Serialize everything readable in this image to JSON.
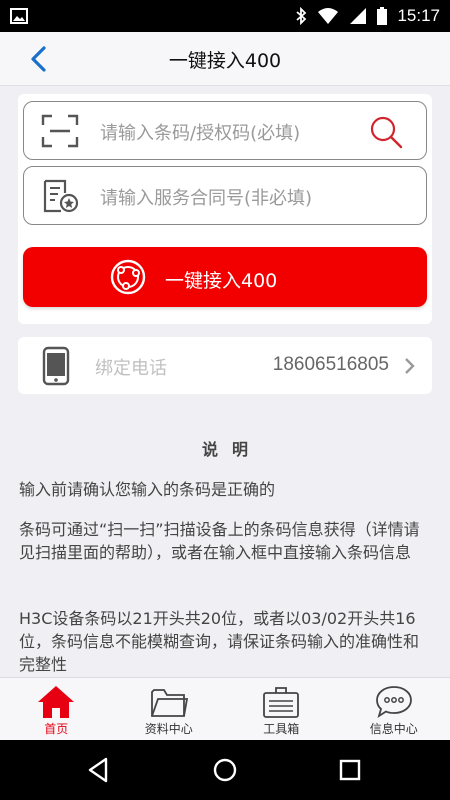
{
  "status_bar": {
    "time": "15:17"
  },
  "header": {
    "title": "一键接入400"
  },
  "form": {
    "barcode_placeholder": "请输入条码/授权码(必填)",
    "contract_placeholder": "请输入服务合同号(非必填)",
    "connect_label": "一键接入400"
  },
  "phone": {
    "label": "绑定电话",
    "number": "18606516805"
  },
  "instructions": {
    "title": "说明",
    "paragraphs": [
      "输入前请确认您输入的条码是正确的",
      "条码可通过“扫一扫”扫描设备上的条码信息获得（详情请见扫描里面的帮助），或者在输入框中直接输入条码信息",
      "H3C设备条码以21开头共20位，或者以03/02开头共16位，条码信息不能模糊查询，请保证条码输入的准确性和完整性"
    ]
  },
  "tabs": [
    {
      "label": "首页",
      "icon": "home-icon",
      "active": true
    },
    {
      "label": "资料中心",
      "icon": "folder-icon",
      "active": false
    },
    {
      "label": "工具箱",
      "icon": "toolbox-icon",
      "active": false
    },
    {
      "label": "信息中心",
      "icon": "chat-icon",
      "active": false
    }
  ],
  "colors": {
    "accent": "#e60012",
    "button": "#f20000",
    "back": "#1a6fc9"
  }
}
